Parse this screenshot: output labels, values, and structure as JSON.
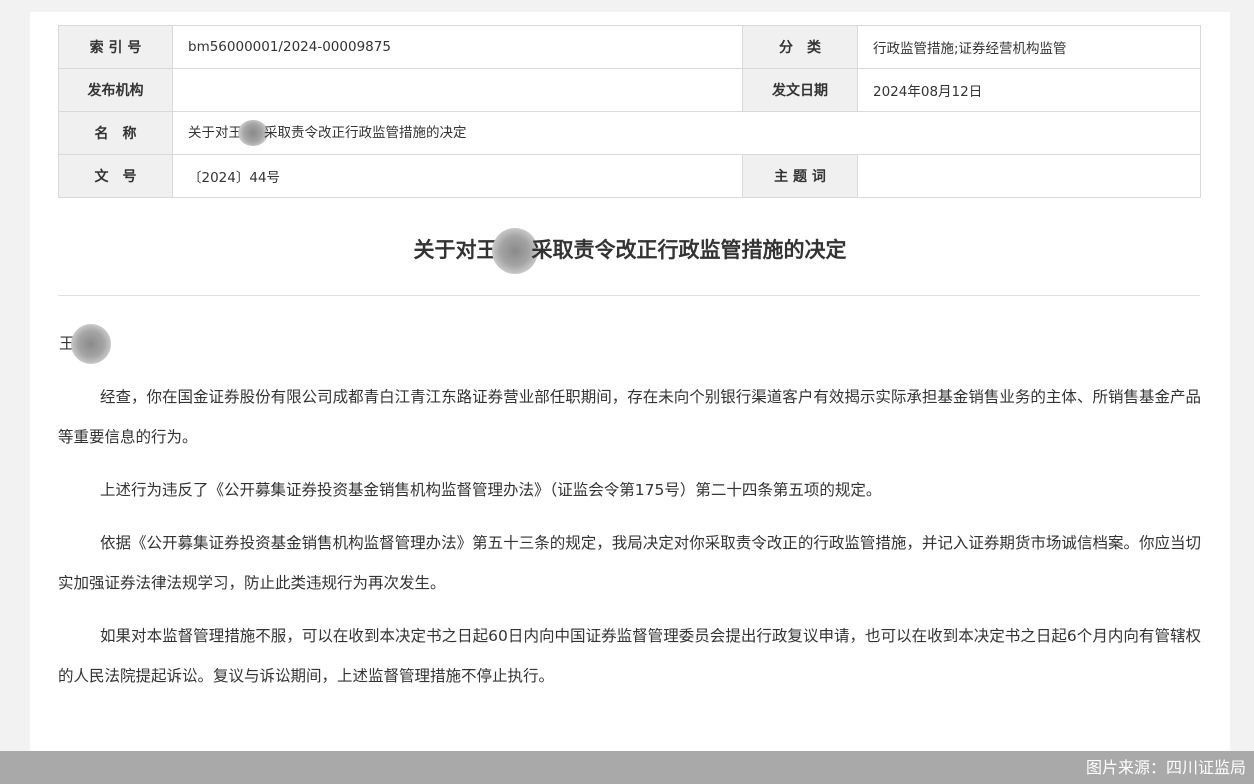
{
  "meta": {
    "rows": [
      {
        "label1": "索 引 号",
        "value1": "bm56000001/2024-00009875",
        "label2": "分　类",
        "value2": "行政监管措施;证券经营机构监管"
      },
      {
        "label1": "发布机构",
        "value1": "",
        "label2": "发文日期",
        "value2": "2024年08月12日"
      },
      {
        "label1": "名　称",
        "value_prefix": "关于对王",
        "value_suffix": "采取责令改正行政监管措施的决定"
      },
      {
        "label1": "文　号",
        "value1": "〔2024〕44号",
        "label2": "主 题 词",
        "value2": ""
      }
    ]
  },
  "document": {
    "title_prefix": "关于对王",
    "title_suffix": "采取责令改正行政监管措施的决定",
    "addressee": "王",
    "paragraphs": [
      "经查，你在国金证券股份有限公司成都青白江青江东路证券营业部任职期间，存在未向个别银行渠道客户有效揭示实际承担基金销售业务的主体、所销售基金产品等重要信息的行为。",
      "上述行为违反了《公开募集证券投资基金销售机构监督管理办法》（证监会令第175号）第二十四条第五项的规定。",
      "依据《公开募集证券投资基金销售机构监督管理办法》第五十三条的规定，我局决定对你采取责令改正的行政监管措施，并记入证券期货市场诚信档案。你应当切实加强证券法律法规学习，防止此类违规行为再次发生。",
      "如果对本监督管理措施不服，可以在收到本决定书之日起60日内向中国证券监督管理委员会提出行政复议申请，也可以在收到本决定书之日起6个月内向有管辖权的人民法院提起诉讼。复议与诉讼期间，上述监督管理措施不停止执行。"
    ]
  },
  "footer": {
    "credit": "图片来源：四川证监局"
  }
}
